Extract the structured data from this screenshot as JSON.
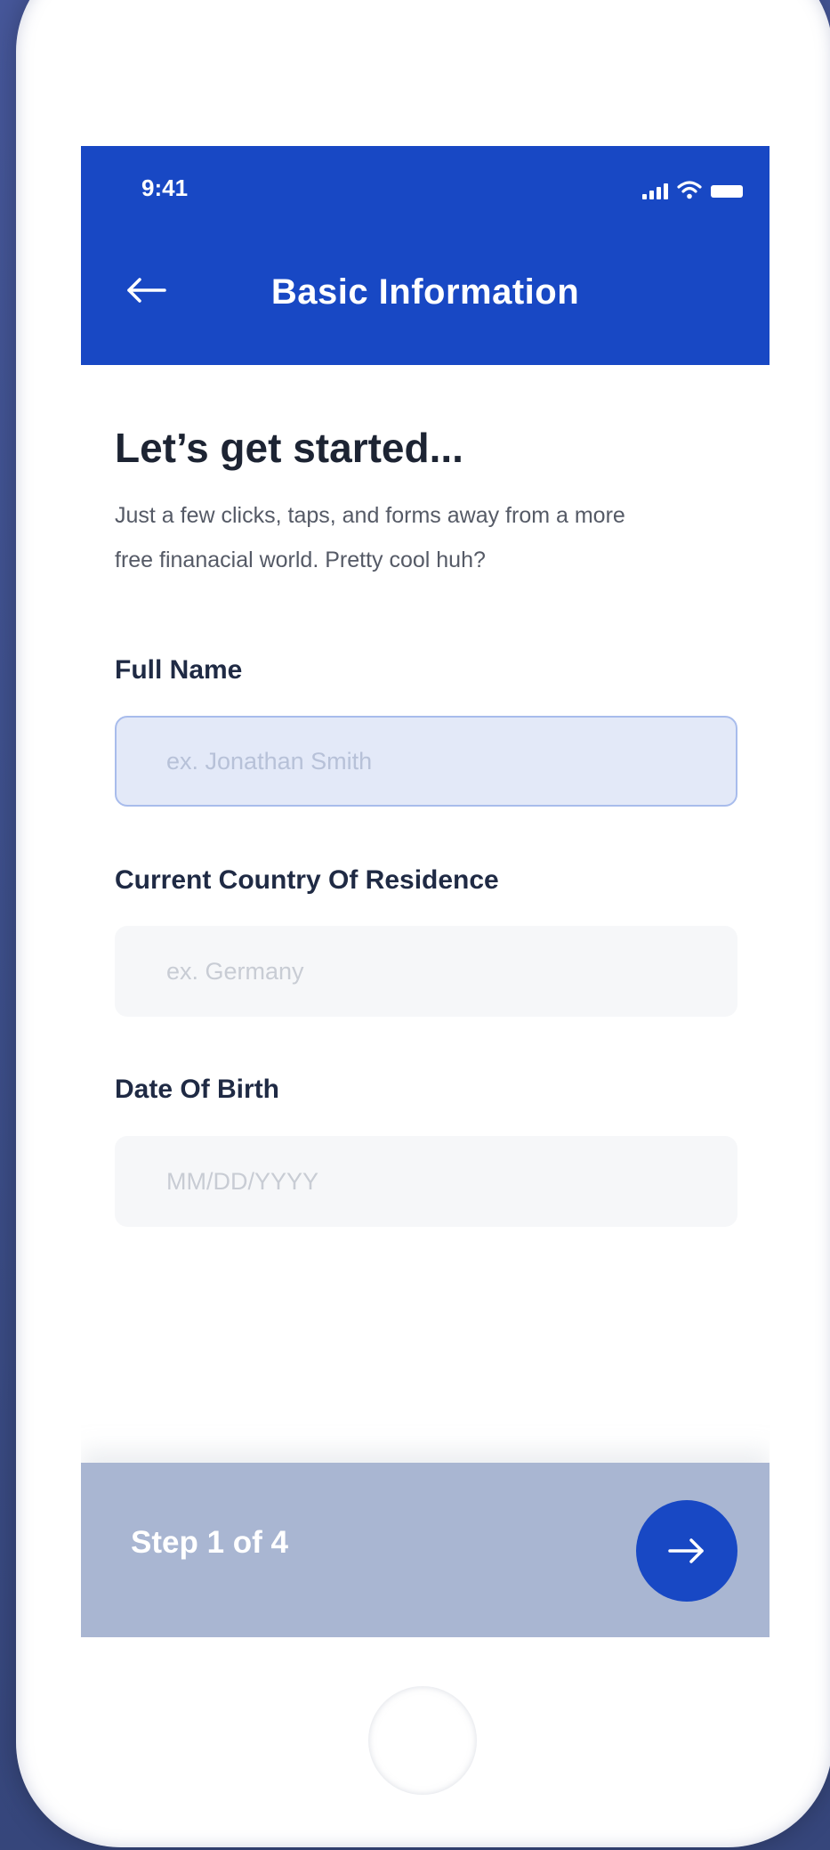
{
  "status_bar": {
    "time": "9:41"
  },
  "header": {
    "title": "Basic Information",
    "background_color": "#1848c4"
  },
  "intro": {
    "heading": "Let’s get started...",
    "subtext_line1": "Just a few clicks, taps, and forms away from a more",
    "subtext_line2": "free finanacial world. Pretty cool huh?"
  },
  "form": {
    "full_name": {
      "label": "Full Name",
      "placeholder": "ex. Jonathan Smith",
      "value": ""
    },
    "country": {
      "label": "Current Country Of Residence",
      "placeholder": "ex. Germany",
      "value": ""
    },
    "dob": {
      "label": "Date Of Birth",
      "placeholder": "MM/DD/YYYY",
      "value": ""
    }
  },
  "footer": {
    "step_text": "Step 1 of 4",
    "accent_color": "#1848c4"
  },
  "icons": {
    "back": "arrow-left-icon",
    "next": "arrow-right-icon",
    "signal": "cellular-signal-icon",
    "wifi": "wifi-icon",
    "battery": "battery-icon"
  }
}
